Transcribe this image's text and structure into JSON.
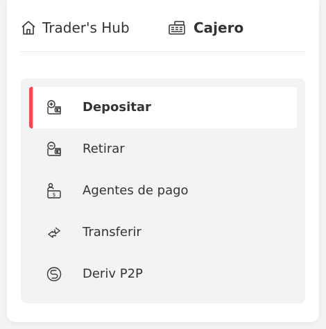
{
  "header": {
    "hub_label": "Trader's Hub",
    "hub_icon": "home-icon",
    "cashier_label": "Cajero",
    "cashier_icon": "cashier-icon"
  },
  "menu": {
    "active_color": "#ff444f",
    "items": [
      {
        "label": "Depositar",
        "icon": "deposit-icon",
        "active": true
      },
      {
        "label": "Retirar",
        "icon": "withdraw-icon",
        "active": false
      },
      {
        "label": "Agentes de pago",
        "icon": "payment-agent-icon",
        "active": false
      },
      {
        "label": "Transferir",
        "icon": "transfer-icon",
        "active": false
      },
      {
        "label": "Deriv P2P",
        "icon": "p2p-icon",
        "active": false
      }
    ]
  }
}
